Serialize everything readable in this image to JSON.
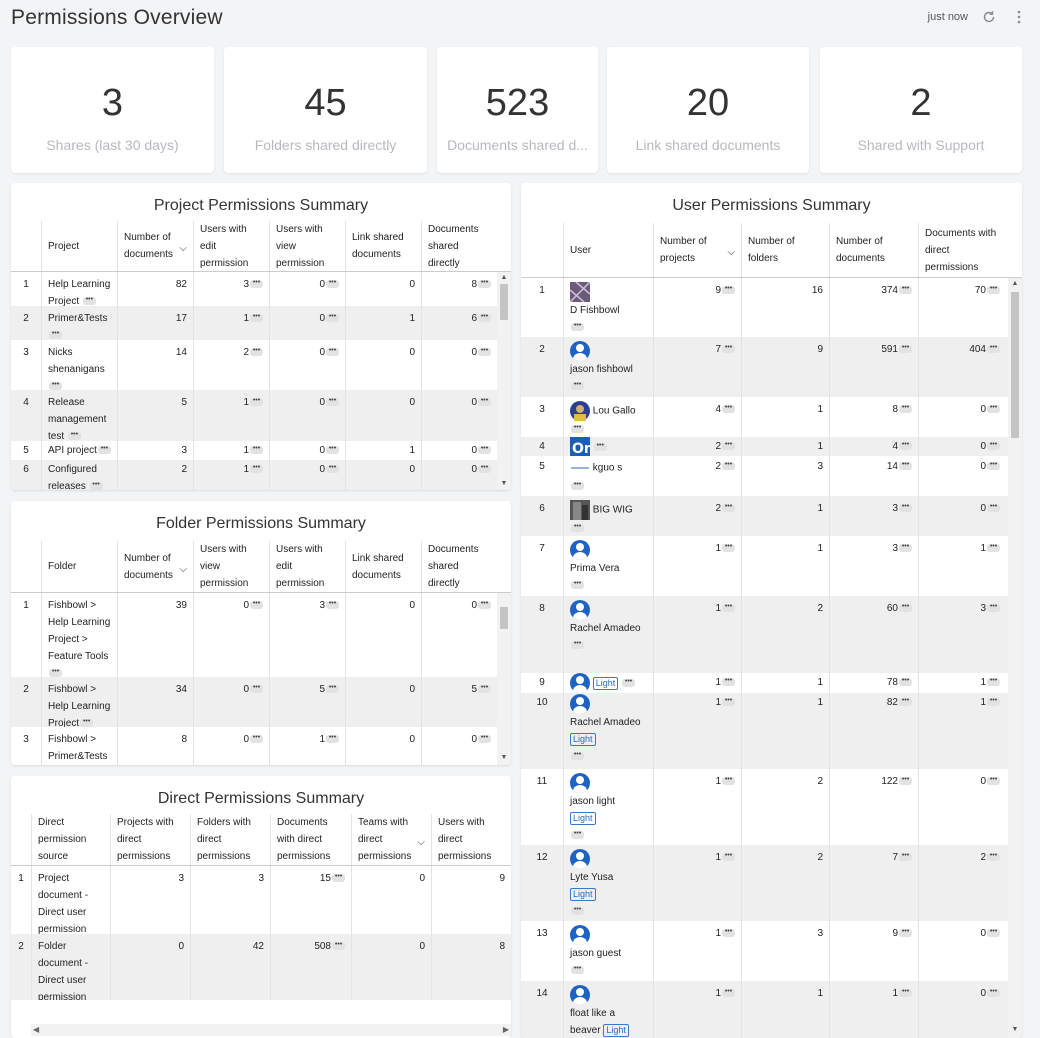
{
  "header": {
    "title": "Permissions Overview",
    "updated": "just now",
    "refresh_icon": "refresh-icon",
    "menu_icon": "more-vertical-icon"
  },
  "kpis": [
    {
      "value": "3",
      "label": "Shares (last 30 days)"
    },
    {
      "value": "45",
      "label": "Folders shared directly"
    },
    {
      "value": "523",
      "label": "Documents shared d..."
    },
    {
      "value": "20",
      "label": "Link shared documents"
    },
    {
      "value": "2",
      "label": "Shared with Support"
    }
  ],
  "project_summary": {
    "title": "Project Permissions Summary",
    "headers": [
      "Project",
      "Number of documents",
      "Users with edit permission",
      "Users with view permission",
      "Link shared documents",
      "Documents shared directly"
    ],
    "rows": [
      {
        "n": "1",
        "name": "Help Learning Project",
        "docs": "82",
        "edit": "3",
        "view": "0",
        "link": "0",
        "direct": "8"
      },
      {
        "n": "2",
        "name": "Primer&Tests",
        "docs": "17",
        "edit": "1",
        "view": "0",
        "link": "1",
        "direct": "6"
      },
      {
        "n": "3",
        "name": "Nicks shenanigans",
        "docs": "14",
        "edit": "2",
        "view": "0",
        "link": "0",
        "direct": "0"
      },
      {
        "n": "4",
        "name": "Release management test",
        "docs": "5",
        "edit": "1",
        "view": "0",
        "link": "0",
        "direct": "0"
      },
      {
        "n": "5",
        "name": "API project",
        "docs": "3",
        "edit": "1",
        "view": "0",
        "link": "1",
        "direct": "0"
      },
      {
        "n": "6",
        "name": "Configured releases",
        "docs": "2",
        "edit": "1",
        "view": "0",
        "link": "0",
        "direct": "0"
      }
    ]
  },
  "folder_summary": {
    "title": "Folder Permissions Summary",
    "headers": [
      "Folder",
      "Number of documents",
      "Users with view permission",
      "Users with edit permission",
      "Link shared documents",
      "Documents shared directly"
    ],
    "rows": [
      {
        "n": "1",
        "name": "Fishbowl > Help Learning Project > Feature Tools",
        "docs": "39",
        "view": "0",
        "edit": "3",
        "link": "0",
        "direct": "0"
      },
      {
        "n": "2",
        "name": "Fishbowl > Help Learning Project",
        "docs": "34",
        "view": "0",
        "edit": "5",
        "link": "0",
        "direct": "5"
      },
      {
        "n": "3",
        "name": "Fishbowl > Primer&Tests",
        "docs": "8",
        "view": "0",
        "edit": "1",
        "link": "0",
        "direct": "0"
      }
    ]
  },
  "direct_summary": {
    "title": "Direct Permissions Summary",
    "headers": [
      "Direct permission source",
      "Projects with direct permissions",
      "Folders with direct permissions",
      "Documents with direct permissions",
      "Teams with direct permissions",
      "Users with direct permissions"
    ],
    "rows": [
      {
        "n": "1",
        "source": "Project document - Direct user permission",
        "projects": "3",
        "folders": "3",
        "docs": "15",
        "teams": "0",
        "users": "9"
      },
      {
        "n": "2",
        "source": "Folder document - Direct user permission",
        "projects": "0",
        "folders": "42",
        "docs": "508",
        "teams": "0",
        "users": "8"
      }
    ]
  },
  "user_summary": {
    "title": "User Permissions Summary",
    "headers": [
      "User",
      "Number of projects",
      "Number of folders",
      "Number of documents",
      "Documents with direct permissions"
    ],
    "light_badge": "Light",
    "rows": [
      {
        "n": "1",
        "name": "D Fishbowl",
        "avatar": "photo",
        "projects": "9",
        "folders": "16",
        "docs": "374",
        "direct": "70"
      },
      {
        "n": "2",
        "name": "jason fishbowl",
        "avatar": "default",
        "projects": "7",
        "folders": "9",
        "docs": "591",
        "direct": "404"
      },
      {
        "n": "3",
        "name": "Lou Gallo",
        "avatar": "photo",
        "projects": "4",
        "folders": "1",
        "docs": "8",
        "direct": "0"
      },
      {
        "n": "4",
        "name": "",
        "avatar": "photo",
        "projects": "2",
        "folders": "1",
        "docs": "4",
        "direct": "0"
      },
      {
        "n": "5",
        "name": "kguo s",
        "avatar": "photo",
        "projects": "2",
        "folders": "3",
        "docs": "14",
        "direct": "0"
      },
      {
        "n": "6",
        "name": "BIG WIG",
        "avatar": "photo",
        "projects": "2",
        "folders": "1",
        "docs": "3",
        "direct": "0"
      },
      {
        "n": "7",
        "name": "Prima Vera",
        "avatar": "default",
        "projects": "1",
        "folders": "1",
        "docs": "3",
        "direct": "1"
      },
      {
        "n": "8",
        "name": "Rachel Amadeo",
        "avatar": "default",
        "projects": "1",
        "folders": "2",
        "docs": "60",
        "direct": "3"
      },
      {
        "n": "9",
        "name": "",
        "avatar": "default",
        "light": true,
        "projects": "1",
        "folders": "1",
        "docs": "78",
        "direct": "1"
      },
      {
        "n": "10",
        "name": "Rachel Amadeo",
        "avatar": "default",
        "light": true,
        "projects": "1",
        "folders": "1",
        "docs": "82",
        "direct": "1"
      },
      {
        "n": "11",
        "name": "jason light",
        "avatar": "default",
        "light": true,
        "projects": "1",
        "folders": "2",
        "docs": "122",
        "direct": "0"
      },
      {
        "n": "12",
        "name": "Lyte Yusa",
        "avatar": "default",
        "light": true,
        "projects": "1",
        "folders": "2",
        "docs": "7",
        "direct": "2"
      },
      {
        "n": "13",
        "name": "jason guest",
        "avatar": "default",
        "projects": "1",
        "folders": "3",
        "docs": "9",
        "direct": "0"
      },
      {
        "n": "14",
        "name": "float like a beaver",
        "avatar": "default",
        "light": true,
        "projects": "1",
        "folders": "1",
        "docs": "1",
        "direct": "0"
      }
    ]
  }
}
